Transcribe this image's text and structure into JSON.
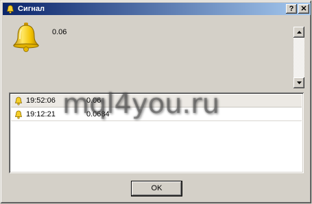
{
  "window": {
    "title": "Сигнал",
    "help_label": "?",
    "close_label": "✕"
  },
  "signal": {
    "value": "0.06"
  },
  "list": {
    "rows": [
      {
        "time": "19:52:06",
        "value": "0.06"
      },
      {
        "time": "19:12:21",
        "value": "0.0684"
      }
    ]
  },
  "watermark": "mql4you.ru",
  "ok_label": "OK",
  "colors": {
    "titlebar_start": "#0a246a",
    "titlebar_end": "#a6caf0",
    "bell": "#f2c200"
  }
}
